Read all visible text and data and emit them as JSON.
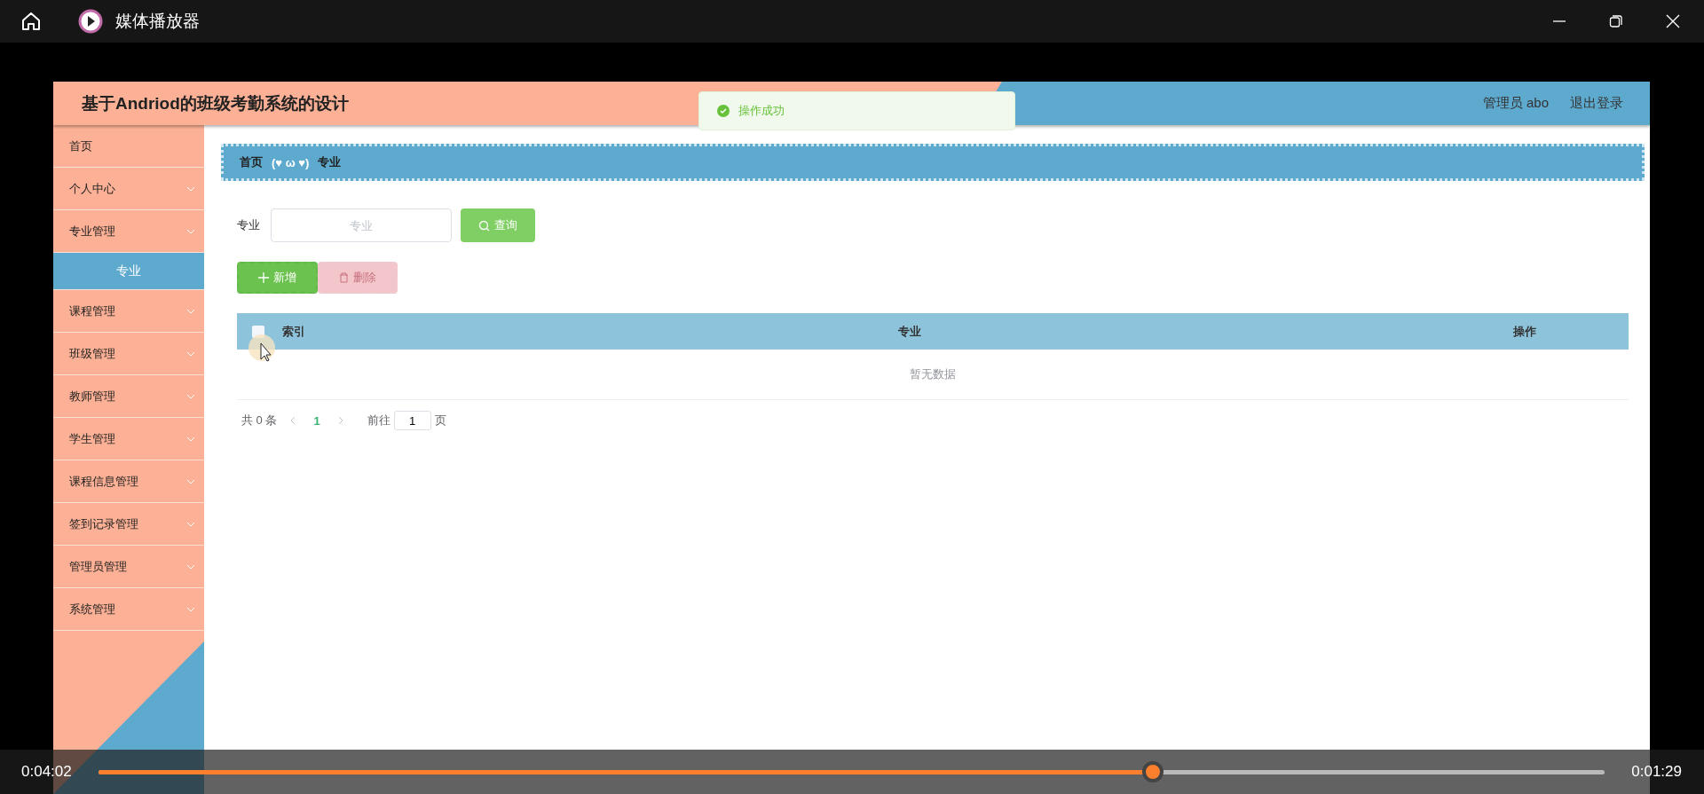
{
  "window": {
    "title": "媒体播放器"
  },
  "app": {
    "title": "基于Andriod的班级考勤系统的设计",
    "user": "管理员 abo",
    "logout": "退出登录"
  },
  "toast": {
    "message": "操作成功"
  },
  "sidebar": {
    "items": [
      {
        "label": "首页",
        "kind": "link"
      },
      {
        "label": "个人中心",
        "kind": "menu"
      },
      {
        "label": "专业管理",
        "kind": "menu",
        "children": [
          {
            "label": "专业",
            "selected": true
          }
        ]
      },
      {
        "label": "课程管理",
        "kind": "menu"
      },
      {
        "label": "班级管理",
        "kind": "menu"
      },
      {
        "label": "教师管理",
        "kind": "menu"
      },
      {
        "label": "学生管理",
        "kind": "menu"
      },
      {
        "label": "课程信息管理",
        "kind": "menu"
      },
      {
        "label": "签到记录管理",
        "kind": "menu"
      },
      {
        "label": "管理员管理",
        "kind": "menu"
      },
      {
        "label": "系统管理",
        "kind": "menu"
      }
    ]
  },
  "breadcrumb": {
    "items": [
      "首页",
      "专业"
    ],
    "separator": "(♥ ω ♥)"
  },
  "search": {
    "label": "专业",
    "placeholder": "专业",
    "button": "查询"
  },
  "actions": [
    {
      "label": "新增",
      "kind": "add",
      "disabled": false
    },
    {
      "label": "删除",
      "kind": "delete",
      "disabled": true
    }
  ],
  "table": {
    "select_all": {
      "checked": false
    },
    "columns": [
      "索引",
      "专业",
      "操作"
    ],
    "empty": "暂无数据"
  },
  "pagination": {
    "total": "共 0 条",
    "pages": [
      {
        "label": "1",
        "selected": true
      }
    ],
    "goto": "前往",
    "page_input": "1",
    "suffix": "页"
  },
  "player": {
    "elapsed": "0:04:02",
    "remaining": "0:01:29",
    "level": 0.7
  }
}
